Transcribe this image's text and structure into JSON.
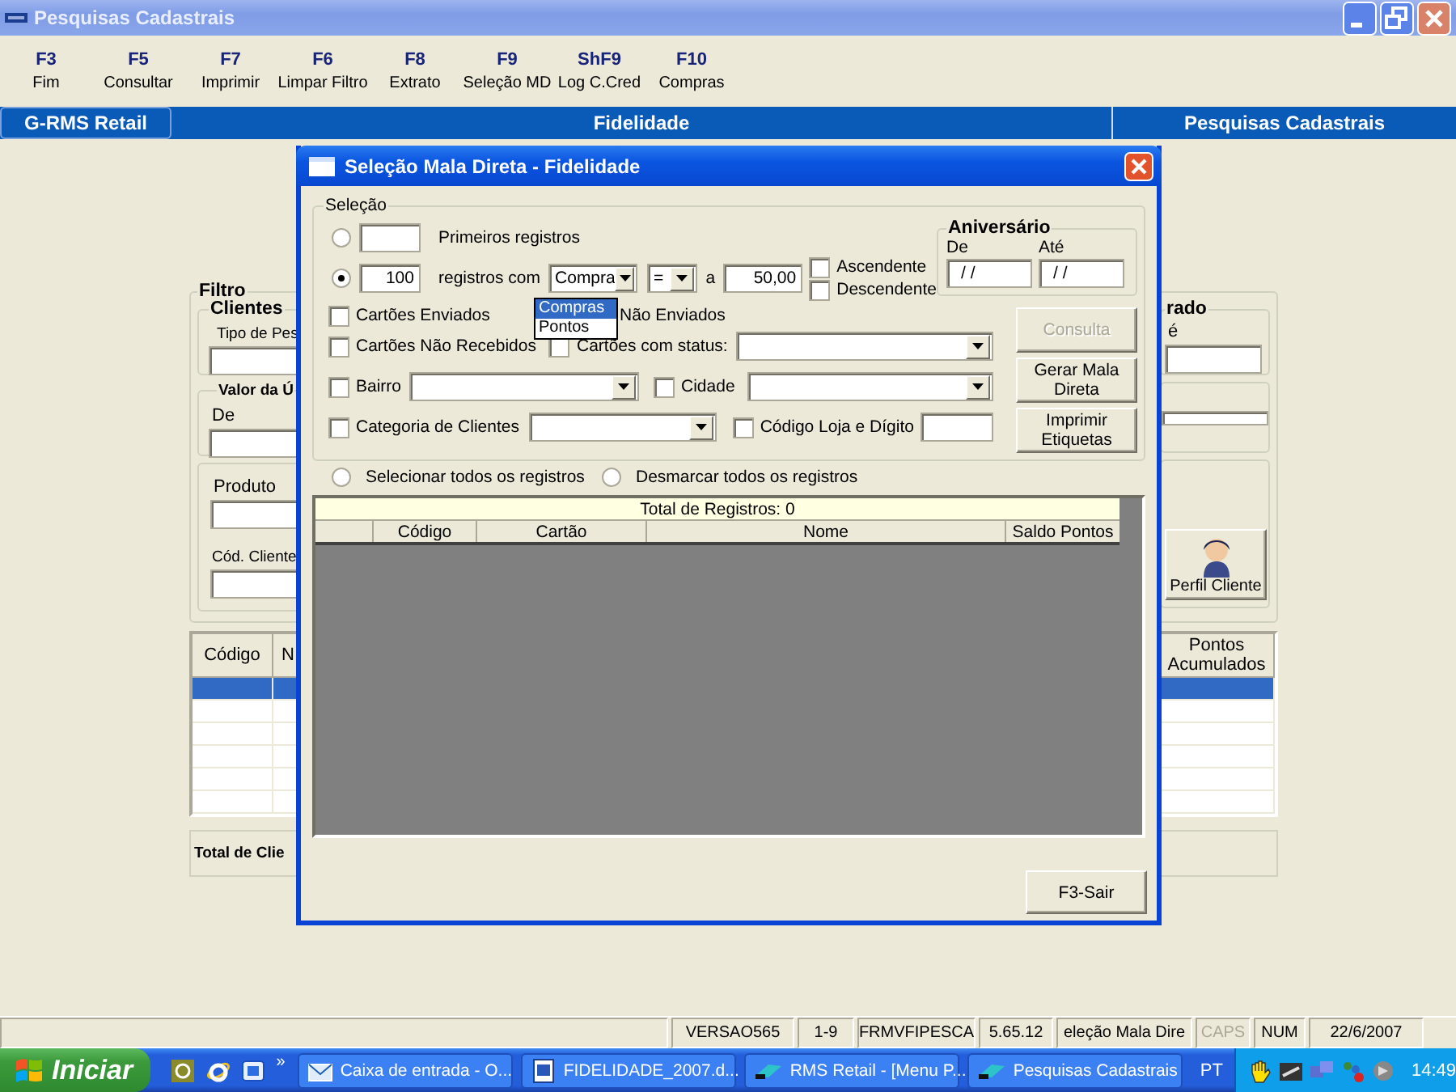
{
  "window": {
    "title": "Pesquisas Cadastrais"
  },
  "function_keys": [
    {
      "key": "F3",
      "label": "Fim"
    },
    {
      "key": "F5",
      "label": "Consultar"
    },
    {
      "key": "F7",
      "label": "Imprimir"
    },
    {
      "key": "F6",
      "label": "Limpar Filtro"
    },
    {
      "key": "F8",
      "label": "Extrato"
    },
    {
      "key": "F9",
      "label": "Seleção MD"
    },
    {
      "key": "ShF9",
      "label": "Log C.Cred"
    },
    {
      "key": "F10",
      "label": "Compras"
    }
  ],
  "header_bar": {
    "left": "G-RMS Retail",
    "center": "Fidelidade",
    "right": "Pesquisas Cadastrais"
  },
  "filter": {
    "title": "Filtro",
    "clientes_group": "Clientes",
    "tipo_label": "Tipo de Pes",
    "valor_group": "Valor da Ú",
    "de_label": "De",
    "produto_label": "Produto",
    "cod_cliente_label": "Cód. Cliente",
    "right_group": "rado",
    "ate_label": "é",
    "profile_button": "Perfil Cliente"
  },
  "results": {
    "columns": [
      "Código",
      "N",
      "Pontos Acumulados"
    ],
    "rows": [
      {
        "selected": true
      },
      {
        "selected": false
      },
      {
        "selected": false
      },
      {
        "selected": false
      },
      {
        "selected": false
      },
      {
        "selected": false
      }
    ]
  },
  "total_label": "Total de Clie",
  "dialog": {
    "title": "Seleção Mala Direta - Fidelidade",
    "selection_group": "Seleção",
    "first_records": {
      "selected": false,
      "label": "Primeiros registros"
    },
    "records_with": {
      "selected": true,
      "value": "100",
      "label": "registros com",
      "field": "Compra",
      "operator": "=",
      "to_label": "a",
      "amount": "50,00"
    },
    "field_options": [
      {
        "label": "Compras",
        "selected": true
      },
      {
        "label": "Pontos",
        "selected": false
      }
    ],
    "order": [
      {
        "label": "Ascendente",
        "checked": false
      },
      {
        "label": "Descendente",
        "checked": false
      }
    ],
    "birthday": {
      "title": "Aniversário",
      "from_label": "De",
      "to_label": "Até",
      "from_value": "/ /",
      "to_value": "/ /"
    },
    "sent_cards": {
      "label": "Cartões Enviados",
      "checked": false
    },
    "not_sent_cards": {
      "label": "Não Enviados"
    },
    "not_received_cards": {
      "label": "Cartões Não Recebidos",
      "checked": false
    },
    "status_cards": {
      "label": "Cartões com status:",
      "checked": false
    },
    "neighborhood": {
      "label": "Bairro",
      "checked": false
    },
    "city": {
      "label": "Cidade",
      "checked": false
    },
    "category": {
      "label": "Categoria de Clientes",
      "checked": false
    },
    "store_code": {
      "label": "Código Loja e Dígito",
      "checked": false
    },
    "buttons": [
      {
        "label": "Consulta",
        "disabled": true
      },
      {
        "label": "Gerar Mala Direta",
        "disabled": false
      },
      {
        "label": "Imprimir Etiquetas",
        "disabled": false
      }
    ],
    "select_options": [
      {
        "label": "Selecionar todos os registros",
        "selected": false
      },
      {
        "label": "Desmarcar todos os registros",
        "selected": false
      }
    ],
    "grid": {
      "total": "Total de Registros: 0",
      "columns": [
        "Código",
        "Cartão",
        "Nome",
        "Saldo Pontos"
      ]
    },
    "exit_button": "F3-Sair"
  },
  "status_bar": [
    {
      "text": "VERSAO565",
      "disabled": false
    },
    {
      "text": "1-9",
      "disabled": false
    },
    {
      "text": "FRMVFIPESCA",
      "disabled": false
    },
    {
      "text": "5.65.12",
      "disabled": false
    },
    {
      "text": "eleção Mala Dire",
      "disabled": false
    },
    {
      "text": "CAPS",
      "disabled": true
    },
    {
      "text": "NUM",
      "disabled": false
    },
    {
      "text": "22/6/2007",
      "disabled": false
    }
  ],
  "taskbar": {
    "start": "Iniciar",
    "more": "»",
    "tasks": [
      {
        "label": "Caixa de entrada - O...",
        "kind": "mail"
      },
      {
        "label": "FIDELIDADE_2007.d...",
        "kind": "document"
      },
      {
        "label": "RMS Retail - [Menu P...",
        "kind": "app"
      },
      {
        "label": "Pesquisas Cadastrais",
        "kind": "app"
      }
    ],
    "language": "PT",
    "clock": "14:49"
  }
}
